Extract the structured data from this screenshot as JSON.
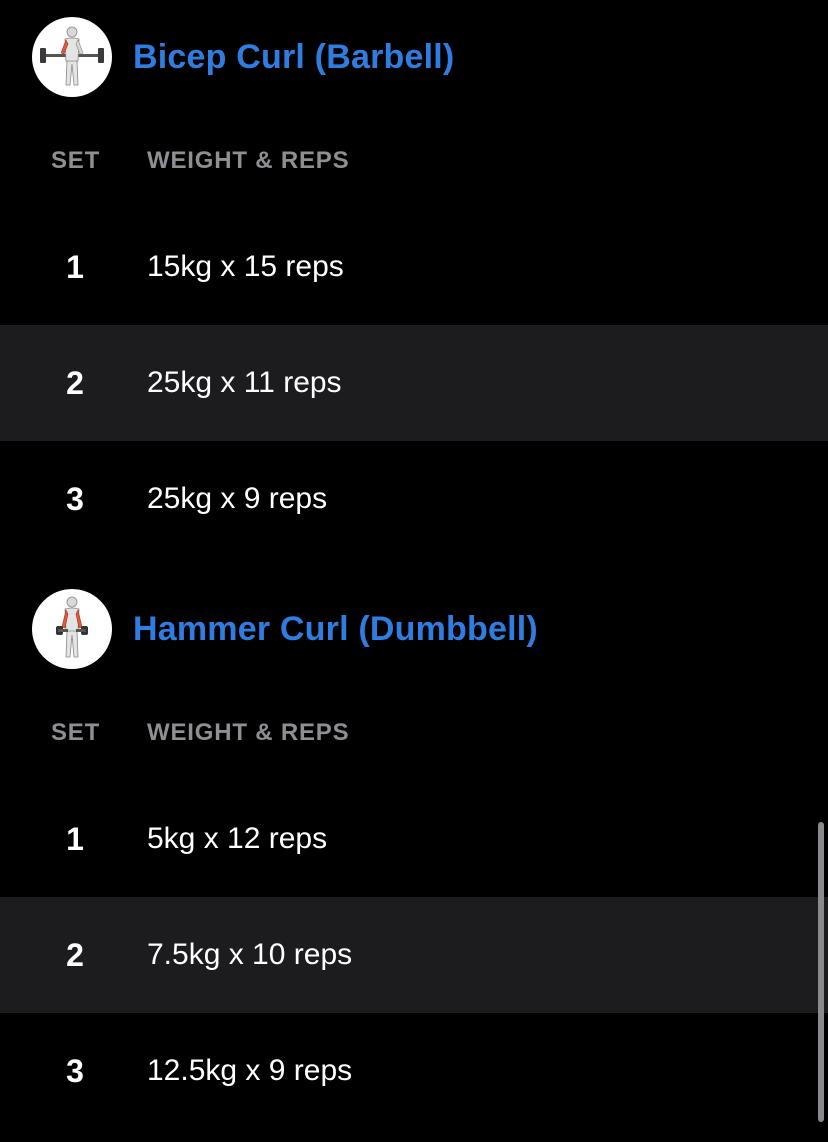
{
  "exercises": [
    {
      "title": "Bicep Curl (Barbell)",
      "thumbnail_icon": "barbell-curl-figure-icon",
      "columns": {
        "set": "SET",
        "weight_reps": "WEIGHT & REPS"
      },
      "sets": [
        {
          "number": "1",
          "value": "15kg x 15 reps"
        },
        {
          "number": "2",
          "value": "25kg x 11 reps"
        },
        {
          "number": "3",
          "value": "25kg x 9 reps"
        }
      ]
    },
    {
      "title": "Hammer Curl (Dumbbell)",
      "thumbnail_icon": "dumbbell-curl-figure-icon",
      "columns": {
        "set": "SET",
        "weight_reps": "WEIGHT & REPS"
      },
      "sets": [
        {
          "number": "1",
          "value": "5kg x 12 reps"
        },
        {
          "number": "2",
          "value": "7.5kg x 10 reps"
        },
        {
          "number": "3",
          "value": "12.5kg x 9 reps"
        }
      ]
    }
  ],
  "colors": {
    "accent": "#2f7de0",
    "background": "#000000",
    "alt_row": "#1c1c1e",
    "header_text": "#8e8e93",
    "muscle_highlight": "#e0593c"
  }
}
